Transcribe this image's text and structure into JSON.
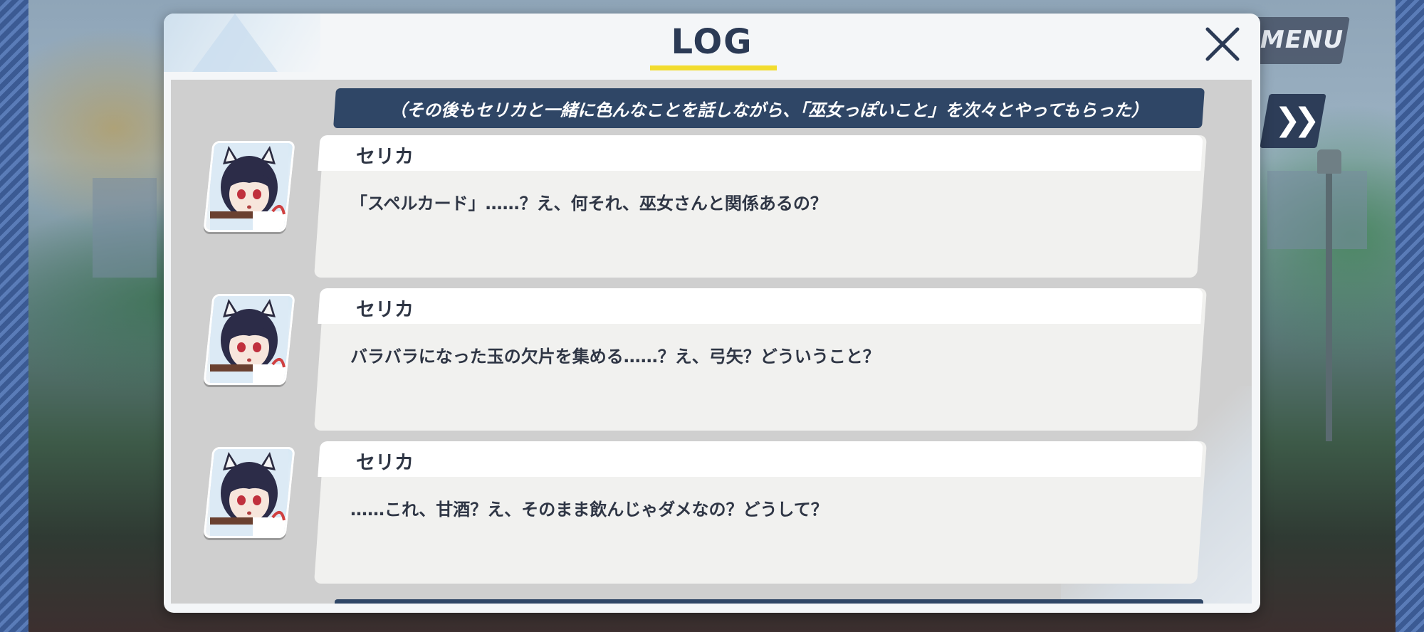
{
  "background": {
    "menu_label": "MENU",
    "skip_icon": "fast-forward-icon"
  },
  "log": {
    "title": "LOG",
    "close_icon": "close-icon",
    "accent_color": "#f2dc2e",
    "narration": "（その後もセリカと一緒に色んなことを話しながら、「巫女っぽいこと」を次々とやってもらった）",
    "entries": [
      {
        "speaker": "セリカ",
        "text": "「スペルカード」……？え、何それ、巫女さんと関係あるの？"
      },
      {
        "speaker": "セリカ",
        "text": "バラバラになった玉の欠片を集める……？え、弓矢？どういうこと？"
      },
      {
        "speaker": "セリカ",
        "text": "……これ、甘酒？え、そのまま飲んじゃダメなの？どうして？"
      }
    ]
  }
}
